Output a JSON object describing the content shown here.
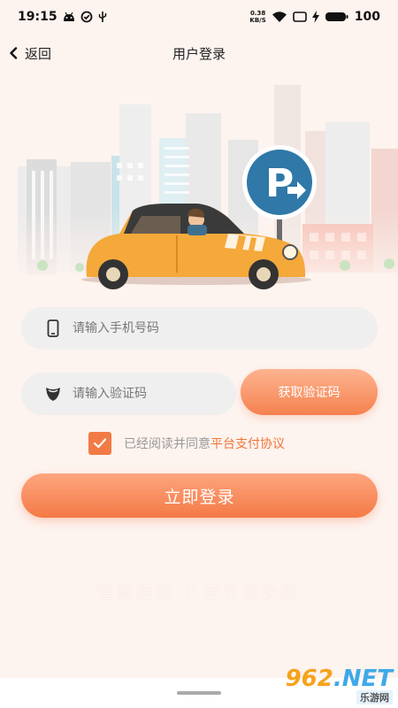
{
  "status_bar": {
    "time": "19:15",
    "speed_value": "0.38",
    "speed_unit": "KB/S",
    "battery": "100",
    "icons": [
      "android-icon",
      "check-circle-icon",
      "usb-icon",
      "wifi-icon",
      "sim-icon",
      "charging-icon",
      "battery-icon"
    ]
  },
  "nav": {
    "back_label": "返回",
    "title": "用户登录"
  },
  "form": {
    "phone_placeholder": "请输入手机号码",
    "code_placeholder": "请输入验证码",
    "get_code_label": "获取验证码",
    "agree_checked": true,
    "agree_prefix": "已经阅读并同意",
    "agree_link": "平台支付协议",
    "login_label": "立即登录"
  },
  "slogan": "智慧停车 让停车更快捷",
  "watermark": {
    "main_number": "962",
    "main_suffix": ".NET",
    "sub": "乐游网"
  },
  "colors": {
    "accent": "#f47a46",
    "background": "#fdf3ef",
    "link": "#ef7638"
  }
}
